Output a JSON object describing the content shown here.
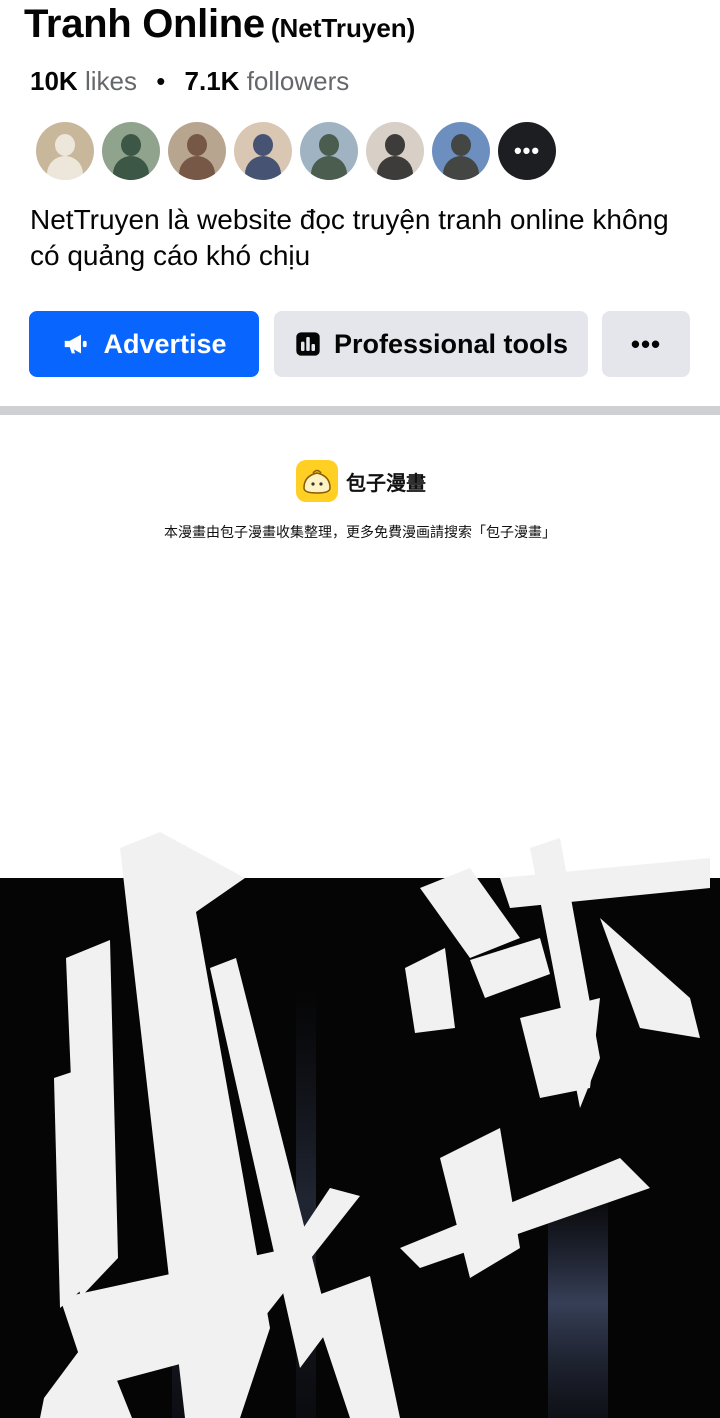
{
  "page": {
    "name": "Tranh Online",
    "name_suffix": "(NetTruyen)",
    "likes_count": "10K",
    "likes_label": "likes",
    "separator": "•",
    "followers_count": "7.1K",
    "followers_label": "followers",
    "description": "NetTruyen là website đọc truyện tranh online không có quảng cáo khó chịu"
  },
  "followers": {
    "avatars": [
      {
        "bg": "#c9b79c",
        "fg": "#f3efe6"
      },
      {
        "bg": "#8fa38d",
        "fg": "#2f4a3a"
      },
      {
        "bg": "#b8a58f",
        "fg": "#6b4a3a"
      },
      {
        "bg": "#d9c7b4",
        "fg": "#2c3e66"
      },
      {
        "bg": "#9fb3c2",
        "fg": "#3b4d3a"
      },
      {
        "bg": "#d8cfc6",
        "fg": "#222222"
      },
      {
        "bg": "#6d8fbf",
        "fg": "#3d3a2e"
      }
    ],
    "more_label": "•••"
  },
  "actions": {
    "advertise_label": "Advertise",
    "tools_label": "Professional tools",
    "more_label": "•••"
  },
  "icons": {
    "advertise": "megaphone-icon",
    "tools": "bar-chart-icon",
    "more": "more-icon"
  },
  "colors": {
    "primary": "#0866ff",
    "secondary_button": "#e4e6eb",
    "divider": "#ced0d4",
    "brand_yellow": "#ffcf24"
  },
  "comic_source": {
    "brand_name": "包子漫畫",
    "notice": "本漫畫由包子漫畫收集整理，更多免費漫画請搜索「包子漫畫」"
  }
}
